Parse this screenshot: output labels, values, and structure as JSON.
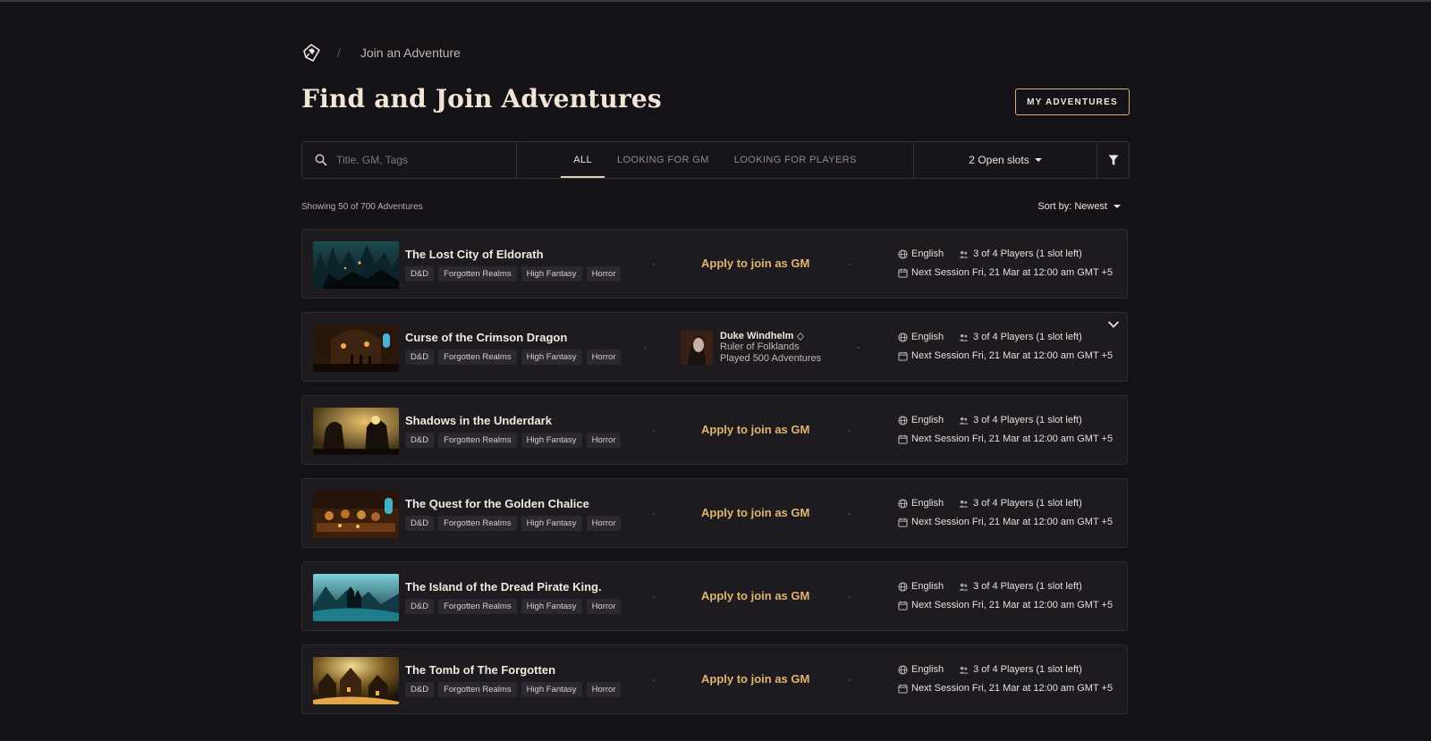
{
  "breadcrumb": {
    "current": "Join an Adventure",
    "separator": "/"
  },
  "page_title": "Find and Join Adventures",
  "my_adventures_label": "MY ADVENTURES",
  "search": {
    "placeholder": "Title, GM, Tags",
    "value": ""
  },
  "tabs": [
    {
      "label": "ALL",
      "active": true
    },
    {
      "label": "LOOKING FOR GM",
      "active": false
    },
    {
      "label": "LOOKING FOR PLAYERS",
      "active": false
    }
  ],
  "open_slots": {
    "count": "2",
    "label": "Open slots"
  },
  "results_count": "Showing 50 of 700 Adventures",
  "sort": {
    "label": "Sort by:",
    "value": "Newest"
  },
  "apply_label": "Apply to join as GM",
  "colors": {
    "accent": "#e0b56e",
    "background": "#141217",
    "card": "#1d1a20",
    "title": "#f1e6d6"
  },
  "adventures": [
    {
      "title": "The Lost City of Eldorath",
      "tags": [
        "D&D",
        "Forgotten Realms",
        "High Fantasy",
        "Horror"
      ],
      "language": "English",
      "players": "3 of 4 Players (1 slot left)",
      "next_session": "Next Session Fri, 21 Mar at 12:00 am GMT +5",
      "icon": "teal-city-landscape"
    },
    {
      "title": "Curse of the Crimson Dragon",
      "tags": [
        "D&D",
        "Forgotten Realms",
        "High Fantasy",
        "Horror"
      ],
      "language": "English",
      "players": "3 of 4 Players (1 slot left)",
      "next_session": "Next Session Fri, 21 Mar at 12:00 am GMT +5",
      "gm": {
        "name": "Duke Windhelm",
        "title": "Ruler of Folklands",
        "played": "Played 500 Adventures"
      },
      "icon": "torchlit-hall"
    },
    {
      "title": "Shadows in the Underdark",
      "tags": [
        "D&D",
        "Forgotten Realms",
        "High Fantasy",
        "Horror"
      ],
      "language": "English",
      "players": "3 of 4 Players (1 slot left)",
      "next_session": "Next Session Fri, 21 Mar at 12:00 am GMT +5",
      "icon": "monsters-silhouette"
    },
    {
      "title": "The Quest for the Golden Chalice",
      "tags": [
        "D&D",
        "Forgotten Realms",
        "High Fantasy",
        "Horror"
      ],
      "language": "English",
      "players": "3 of 4 Players (1 slot left)",
      "next_session": "Next Session Fri, 21 Mar at 12:00 am GMT +5",
      "icon": "tavern-feast"
    },
    {
      "title": "The Island of the Dread Pirate King.",
      "tags": [
        "D&D",
        "Forgotten Realms",
        "High Fantasy",
        "Horror"
      ],
      "language": "English",
      "players": "3 of 4 Players (1 slot left)",
      "next_session": "Next Session Fri, 21 Mar at 12:00 am GMT +5",
      "icon": "island-castle"
    },
    {
      "title": "The Tomb of The Forgotten",
      "tags": [
        "D&D",
        "Forgotten Realms",
        "High Fantasy",
        "Horror"
      ],
      "language": "English",
      "players": "3 of 4 Players (1 slot left)",
      "next_session": "Next Session Fri, 21 Mar at 12:00 am GMT +5",
      "icon": "golden-village"
    }
  ]
}
